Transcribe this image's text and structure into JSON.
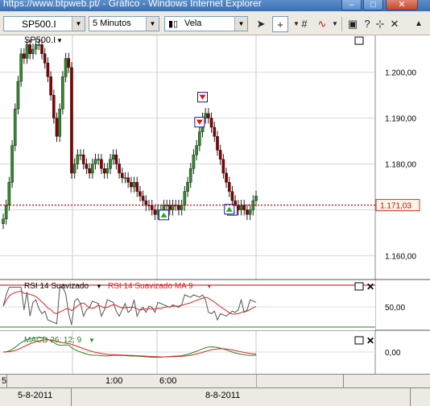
{
  "window": {
    "title": "https://www.btpweb.pt/ - Gráfico - Windows Internet Explorer",
    "minimize_label": "–",
    "maximize_label": "□",
    "close_label": "✕"
  },
  "toolbar": {
    "symbol": "SP500.I",
    "interval": "5 Minutos",
    "chart_style": "Vela"
  },
  "price_panel": {
    "label": "SP500.I",
    "current_price": "1.171,03",
    "y_ticks": [
      "1.200,00",
      "1.190,00",
      "1.180,00",
      "1.170,00",
      "1.160,00"
    ]
  },
  "rsi_panel": {
    "label": "RSI 14 Suavizado",
    "ma_label": "RSI 14 Suavizado MA 9",
    "y_tick": "50,00"
  },
  "macd_panel": {
    "label": "MACD 26; 12; 9",
    "y_tick": "0,00"
  },
  "time_axis": {
    "ticks": [
      "1:00",
      "6:00"
    ],
    "left_stub": "5",
    "dates": [
      "5-8-2011",
      "8-8-2011"
    ]
  },
  "colors": {
    "up_candle": "#2e8b2e",
    "down_candle": "#8b0000",
    "price_line": "#cc0000",
    "rsi_line": "#555555",
    "rsi_ma": "#dd2222",
    "macd_line": "#228822",
    "macd_signal": "#dd2222"
  },
  "chart_data": {
    "type": "candlestick",
    "ylim": [
      1155,
      1208
    ],
    "current_level": 1171.03,
    "closes": [
      1168,
      1171,
      1176,
      1184,
      1192,
      1198,
      1204,
      1203,
      1206,
      1204,
      1205,
      1206,
      1206,
      1204,
      1202,
      1199,
      1195,
      1190,
      1186,
      1192,
      1199,
      1203,
      1201,
      1178,
      1180,
      1182,
      1182,
      1180,
      1179,
      1178,
      1180,
      1181,
      1181,
      1179,
      1178,
      1179,
      1181,
      1182,
      1180,
      1178,
      1177,
      1177,
      1176,
      1175,
      1176,
      1174,
      1173,
      1172,
      1171,
      1171,
      1170,
      1169,
      1170,
      1170,
      1171,
      1171,
      1170,
      1171,
      1171,
      1170,
      1171,
      1174,
      1176,
      1179,
      1182,
      1184,
      1187,
      1190,
      1191,
      1190,
      1188,
      1186,
      1183,
      1181,
      1178,
      1176,
      1174,
      1172,
      1171,
      1170,
      1171,
      1170,
      1169,
      1170,
      1172,
      1173
    ],
    "sell_signals": [
      67,
      66
    ],
    "buy_signals": [
      54,
      77,
      76
    ]
  }
}
